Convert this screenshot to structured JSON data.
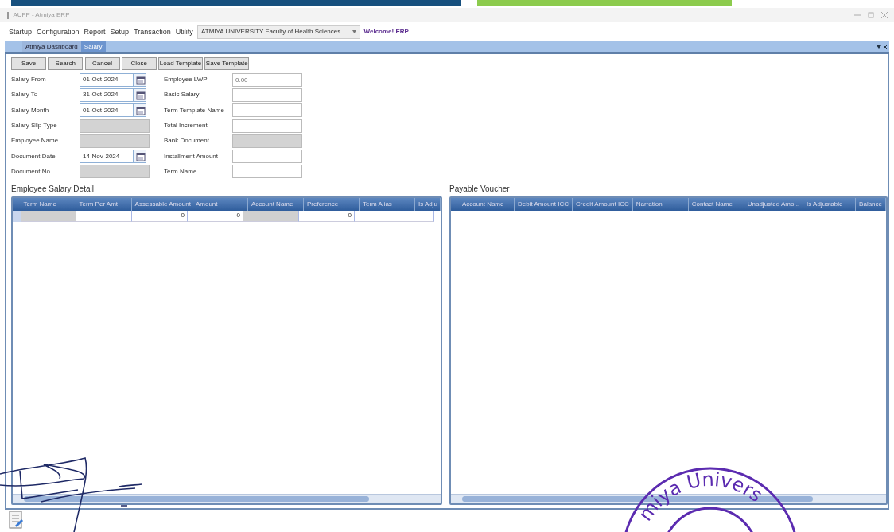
{
  "window": {
    "title": "AUFP - Atmiya ERP"
  },
  "menu": [
    "Startup",
    "Configuration",
    "Report",
    "Setup",
    "Transaction",
    "Utility"
  ],
  "organization_select": {
    "value": "ATMIYA UNIVERSITY Faculty of Health Sciences"
  },
  "welcome": "Welcome! ERP",
  "tabs": [
    {
      "label": "Atmiya Dashboard",
      "selected": false
    },
    {
      "label": "Salary",
      "selected": true
    }
  ],
  "toolbar": [
    "Save",
    "Search",
    "Cancel",
    "Close",
    "Load Template",
    "Save Template"
  ],
  "form_left": [
    {
      "label": "Salary From",
      "kind": "date",
      "value": "01-Oct-2024"
    },
    {
      "label": "Salary To",
      "kind": "date",
      "value": "31-Oct-2024"
    },
    {
      "label": "Salary Month",
      "kind": "date",
      "value": "01-Oct-2024"
    },
    {
      "label": "Salary Slip Type",
      "kind": "text",
      "disabled": true
    },
    {
      "label": "Employee Name",
      "kind": "text",
      "disabled": true
    },
    {
      "label": "Document Date",
      "kind": "date",
      "value": "14-Nov-2024"
    },
    {
      "label": "Document No.",
      "kind": "text",
      "disabled": true
    }
  ],
  "form_right": [
    {
      "label": "Employee LWP",
      "kind": "text",
      "disabled": false,
      "placeholder": "0.00"
    },
    {
      "label": "Basic Salary",
      "kind": "text",
      "disabled": false
    },
    {
      "label": "Term Template Name",
      "kind": "text",
      "disabled": false
    },
    {
      "label": "Total Increment",
      "kind": "text",
      "disabled": false
    },
    {
      "label": "Bank Document",
      "kind": "text",
      "disabled": true
    },
    {
      "label": "Installment Amount",
      "kind": "text",
      "disabled": false
    },
    {
      "label": "Term Name",
      "kind": "text",
      "disabled": false
    }
  ],
  "employee_salary_detail": {
    "title": "Employee Salary Detail",
    "columns": [
      "Term Name",
      "Term Per Amt",
      "Assessable Amount",
      "Amount",
      "Account Name",
      "Preference",
      "Term Alias",
      "Is Adju"
    ],
    "rows": [
      [
        {
          "disabled": true
        },
        {
          "disabled": false
        },
        {
          "value": "0",
          "disabled": false
        },
        {
          "value": "0",
          "disabled": false
        },
        {
          "disabled": true
        },
        {
          "value": "0",
          "disabled": false
        },
        {
          "disabled": false
        },
        {
          "disabled": false
        }
      ]
    ]
  },
  "payable_voucher": {
    "title": "Payable Voucher",
    "columns": [
      "Account Name",
      "Debit Amount ICC",
      "Credit Amount ICC",
      "Narration",
      "Contact Name",
      "Unadjusted Amo...",
      "Is Adjustable",
      "Balance"
    ]
  },
  "stamp": {
    "text": "miya Univers"
  }
}
